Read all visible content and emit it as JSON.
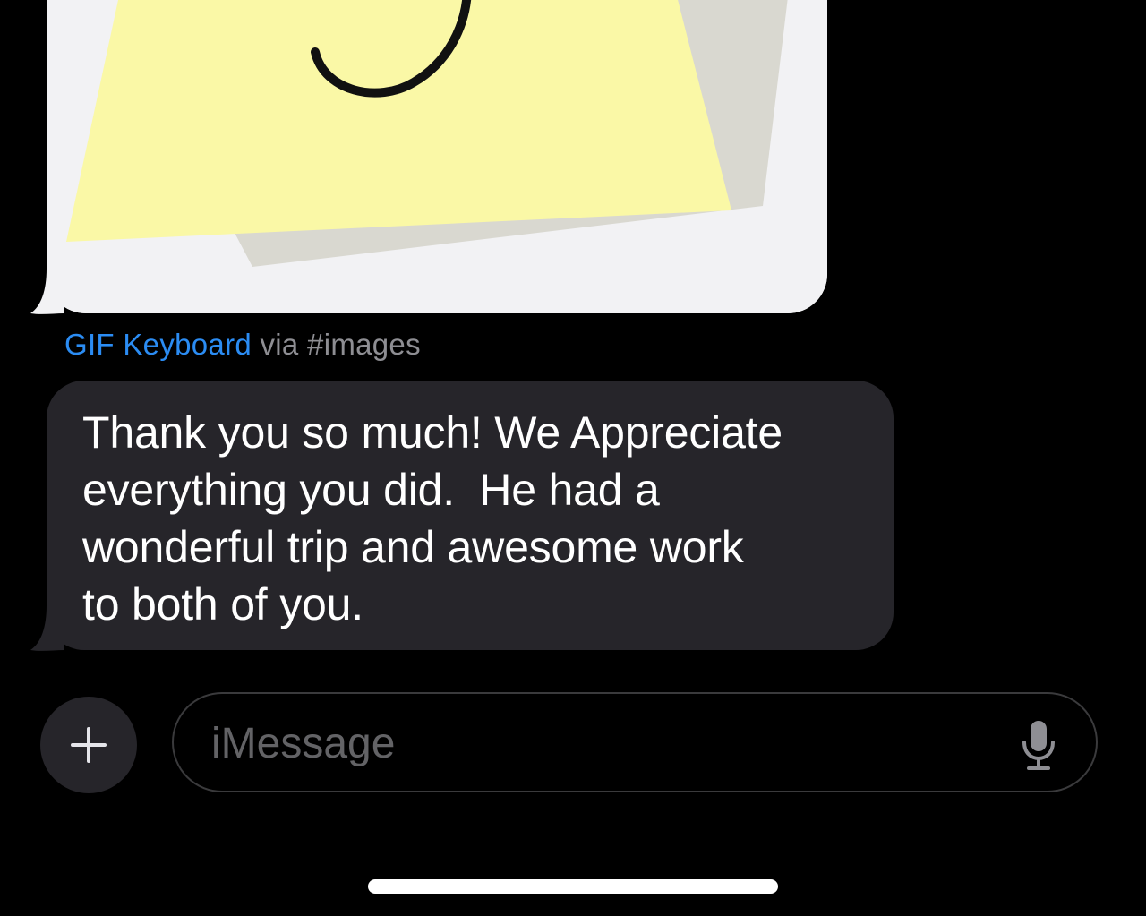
{
  "conversation": {
    "attribution": {
      "source_label": "GIF Keyboard",
      "via_label": " via #images"
    },
    "message": {
      "text": "Thank you so much! We Appreciate\neverything you did.  He had a\nwonderful trip and awesome work\nto both of you."
    }
  },
  "compose": {
    "placeholder": "iMessage",
    "plus_icon": "plus-icon",
    "mic_icon": "microphone-icon"
  },
  "colors": {
    "background": "#000000",
    "bubble_received": "#26252a",
    "link_blue": "#2b8cf3",
    "secondary_text": "#8e8e93",
    "sticky_note": "#faf8a6"
  }
}
